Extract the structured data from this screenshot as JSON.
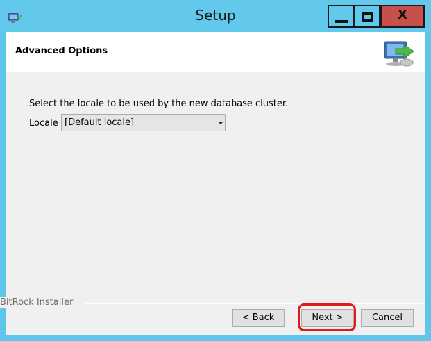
{
  "window": {
    "title": "Setup",
    "close_glyph": "X",
    "accent_color": "#62c8ec",
    "close_color": "#c7504c",
    "icons": [
      "app-icon",
      "minimize-icon",
      "maximize-icon",
      "close-icon",
      "computer-transfer-icon"
    ]
  },
  "header": {
    "title": "Advanced Options"
  },
  "main": {
    "instruction": "Select the locale to be used by the new database cluster.",
    "locale_label": "Locale",
    "locale_value": "[Default locale]"
  },
  "footer": {
    "installer_label": "BitRock Installer",
    "back_label": "< Back",
    "next_label": "Next >",
    "cancel_label": "Cancel",
    "highlight_color": "#e0191b"
  }
}
